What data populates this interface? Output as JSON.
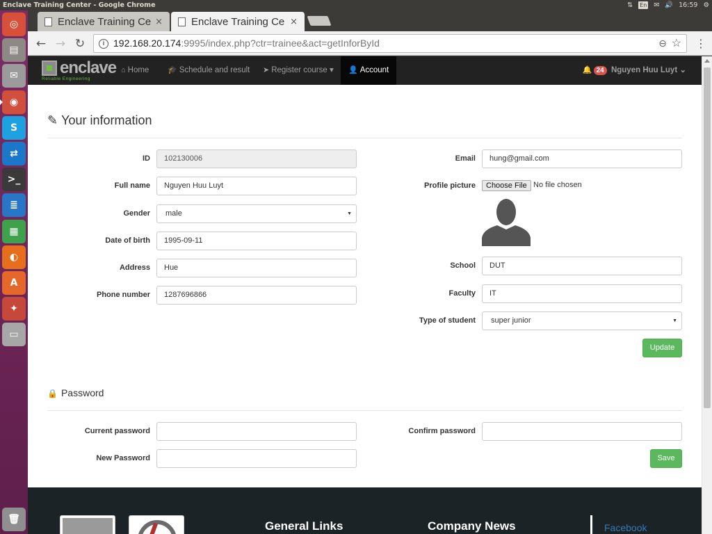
{
  "os": {
    "window_title": "Enclave Training Center - Google Chrome",
    "keyboard_layout": "En",
    "clock": "16:59"
  },
  "launcher": {
    "items": [
      {
        "name": "ubuntu-dash-icon",
        "color": "#d7503a"
      },
      {
        "name": "files-icon",
        "color": "#8d8a86"
      },
      {
        "name": "mail-icon",
        "color": "#9b9b9b"
      },
      {
        "name": "chrome-icon",
        "color": "#d04f3d"
      },
      {
        "name": "skype-icon",
        "color": "#1ea1e0"
      },
      {
        "name": "teamviewer-icon",
        "color": "#1b78c8"
      },
      {
        "name": "terminal-icon",
        "color": "#3a3a3a"
      },
      {
        "name": "writer-icon",
        "color": "#2a76c6"
      },
      {
        "name": "calc-icon",
        "color": "#3ea14b"
      },
      {
        "name": "firefox-icon",
        "color": "#e66e1c"
      },
      {
        "name": "software-center-icon",
        "color": "#e5672a"
      },
      {
        "name": "settings-icon",
        "color": "#c5483a"
      },
      {
        "name": "drive-icon",
        "color": "#a7a7a7"
      },
      {
        "name": "trash-icon",
        "color": "#8f8f8f"
      }
    ]
  },
  "browser": {
    "tabs": [
      {
        "title": "Enclave Training Ce",
        "close": "×"
      },
      {
        "title": "Enclave Training Ce",
        "close": "×"
      }
    ],
    "url_host": "192.168.20.174",
    "url_rest": ":9995/index.php?ctr=trainee&act=getInforById"
  },
  "nav": {
    "logo_word": "enclave",
    "logo_tagline": "Reliable Engineering",
    "home": "Home",
    "schedule": "Schedule and result",
    "register": "Register course",
    "account": "Account",
    "notification_count": "24",
    "user_name": "Nguyen Huu Luyt"
  },
  "info": {
    "title": "Your information",
    "id_label": "ID",
    "id_value": "102130006",
    "fullname_label": "Full name",
    "fullname_value": "Nguyen Huu Luyt",
    "gender_label": "Gender",
    "gender_value": "male",
    "dob_label": "Date of birth",
    "dob_value": "1995-09-11",
    "address_label": "Address",
    "address_value": "Hue",
    "phone_label": "Phone number",
    "phone_value": "1287696866",
    "email_label": "Email",
    "email_value": "hung@gmail.com",
    "picture_label": "Profile picture",
    "choose_file": "Choose File",
    "no_file": "No file chosen",
    "school_label": "School",
    "school_value": "DUT",
    "faculty_label": "Faculty",
    "faculty_value": "IT",
    "type_label": "Type of student",
    "type_value": "super junior",
    "update_button": "Update"
  },
  "password": {
    "title": "Password",
    "current_label": "Current password",
    "new_label": "New Password",
    "confirm_label": "Confirm password",
    "save_button": "Save"
  },
  "footer": {
    "general_links": "General Links",
    "company_news": "Company News",
    "facebook": "Facebook"
  },
  "colors": {
    "navbar": "#222222",
    "success": "#5cb85c",
    "badge": "#d9534f",
    "footer": "#1c2326",
    "link": "#337ab7"
  }
}
